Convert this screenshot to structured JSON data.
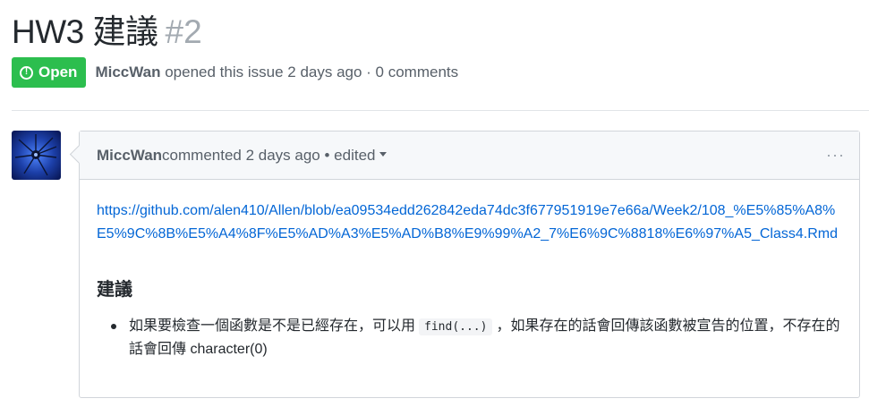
{
  "issue": {
    "title": "HW3 建議",
    "number": "#2",
    "state": "Open",
    "state_icon": "issue-opened-icon",
    "author": "MiccWan",
    "meta": " opened this issue 2 days ago · 0 comments"
  },
  "comment": {
    "author": "MiccWan",
    "meta": " commented 2 days ago • edited",
    "menu_icon": "···",
    "link": "https://github.com/alen410/Allen/blob/ea09534edd262842eda74dc3f677951919e7e66a/Week2/108_%E5%85%A8%E5%9C%8B%E5%A4%8F%E5%AD%A3%E5%AD%B8%E9%99%A2_7%E6%9C%8818%E6%97%A5_Class4.Rmd",
    "heading": "建議",
    "bullets": [
      {
        "before": "如果要檢查一個函數是不是已經存在，可以用",
        "code": "find(...)",
        "after": "，如果存在的話會回傳該函數被宣告的位置，不存在的話會回傳 character(0)"
      }
    ]
  },
  "colors": {
    "open_green": "#2cbe4e",
    "link_blue": "#0366d6",
    "avatar_bg": "#1c3fa8"
  }
}
